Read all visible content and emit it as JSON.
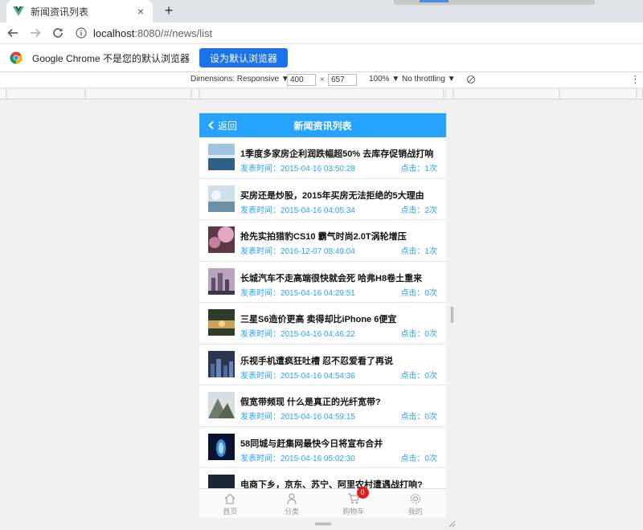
{
  "browser": {
    "tab_title": "新闻资讯列表",
    "tab_close": "×",
    "new_tab": "+",
    "url_host": "localhost",
    "url_rest": ":8080/#/news/list",
    "infobar_message": "Google Chrome 不是您的默认浏览器",
    "infobar_button": "设为默认浏览器"
  },
  "devtools": {
    "dimensions_label": "Dimensions: Responsive ▼",
    "width_value": "400",
    "times": "×",
    "height_value": "657",
    "zoom": "100% ▼",
    "throttling": "No throttling ▼",
    "menu": "⋮"
  },
  "app": {
    "back_label": "返回",
    "title": "新闻资讯列表",
    "news": [
      {
        "title": "1季度多家房企利润跌幅超50% 去库存促销战打响",
        "time": "发表时间：2015-04-16 03:50:28",
        "clicks": "点击：1次",
        "thumb": "sea-thumb"
      },
      {
        "title": "买房还是炒股，2015年买房无法拒绝的5大理由",
        "time": "发表时间：2015-04-16 04:05:34",
        "clicks": "点击：2次",
        "thumb": "sky-thumb"
      },
      {
        "title": "抢先实拍猎豹CS10 霸气时尚2.0T涡轮增压",
        "time": "发表时间：2016-12-07 08:49:04",
        "clicks": "点击：1次",
        "thumb": "blossom-thumb"
      },
      {
        "title": "长城汽车不走高端很快就会死 哈弗H8卷土重来",
        "time": "发表时间：2015-04-16 04:29:51",
        "clicks": "点击：0次",
        "thumb": "city-thumb"
      },
      {
        "title": "三星S6造价更高 卖得却比iPhone 6便宜",
        "time": "发表时间：2015-04-16 04:46:22",
        "clicks": "点击：0次",
        "thumb": "lake-thumb"
      },
      {
        "title": "乐视手机遭疯狂吐槽 忍不忍爱看了再说",
        "time": "发表时间：2015-04-16 04:54:36",
        "clicks": "点击：0次",
        "thumb": "skyline-thumb"
      },
      {
        "title": "假宽带频现 什么是真正的光纤宽带?",
        "time": "发表时间：2015-04-16 04:59:15",
        "clicks": "点击：0次",
        "thumb": "mountain-thumb"
      },
      {
        "title": "58同城与赶集网最快今日将宣布合并",
        "time": "发表时间：2015-04-16 05:02:30",
        "clicks": "点击：0次",
        "thumb": "glow-thumb"
      },
      {
        "title": "电商下乡，京东、苏宁、阿里农村遭遇战打响?",
        "time": "",
        "clicks": "",
        "thumb": "dusk-thumb"
      }
    ],
    "tabbar": [
      {
        "label": "首页",
        "icon": "home-icon"
      },
      {
        "label": "分类",
        "icon": "category-icon"
      },
      {
        "label": "购物车",
        "icon": "cart-icon",
        "badge": "0"
      },
      {
        "label": "我的",
        "icon": "settings-icon"
      }
    ]
  },
  "colors": {
    "accent": "#26a2ff",
    "badge": "#e31d1d",
    "chrome_button": "#1a73e8"
  }
}
